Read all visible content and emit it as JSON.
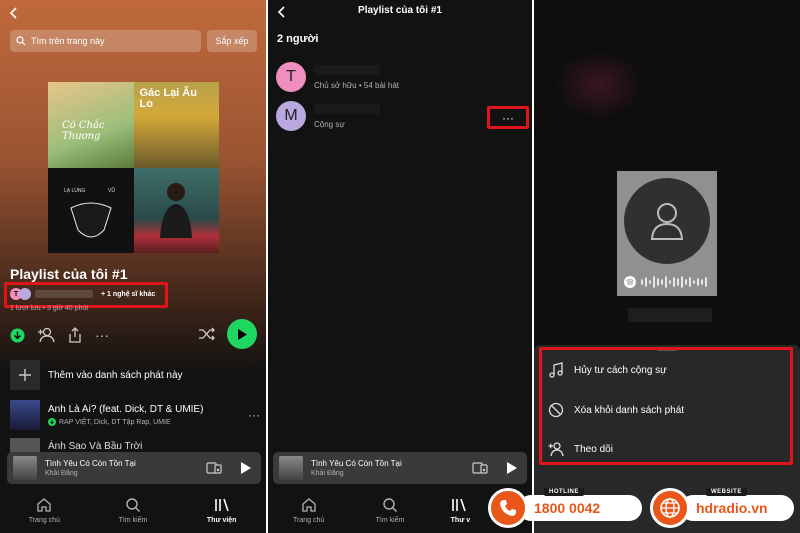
{
  "panel1": {
    "search_placeholder": "Tìm trên trang này",
    "sort_label": "Sắp xếp",
    "playlist_title": "Playlist của tôi #1",
    "collab_text": "+ 1 nghệ sĩ khác",
    "avatar_letter": "T",
    "meta": "1 lượt lưu • 3 giờ 40 phút",
    "add_label": "Thêm vào danh sách phát này",
    "tracks": [
      {
        "title": "Anh Là Ai? (feat. Dick, DT & UMIE)",
        "artist": "RAP VIỆT, Dick, DT Tập Rap, UMIE"
      },
      {
        "title": "Ánh Sao Và Bầu Trời",
        "artist": ""
      }
    ],
    "cover_texts": [
      "Gác Lại Âu Lo",
      "LẠ LÙNG",
      "VŨ",
      "Có Chắc Thương"
    ]
  },
  "miniplayer": {
    "title": "Tình Yêu Có Còn Tồn Tại",
    "artist": "Khải Đăng"
  },
  "nav": {
    "home": "Trang chủ",
    "search": "Tìm kiếm",
    "library": "Thư viện",
    "library_short": "Thư v"
  },
  "panel2": {
    "title": "Playlist của tôi #1",
    "people_count": "2 người",
    "members": [
      {
        "letter": "T",
        "role": "Chủ sở hữu • 54 bài hát",
        "color": "#f08fbf"
      },
      {
        "letter": "M",
        "role": "Cộng sự",
        "color": "#b9a7e0"
      }
    ],
    "more": "···"
  },
  "panel3": {
    "menu": [
      "Hủy tư cách cộng sự",
      "Xóa khỏi danh sách phát",
      "Theo dõi"
    ]
  },
  "branding": {
    "hotline_tag": "HOTLINE",
    "hotline": "1800 0042",
    "website_tag": "WEBSITE",
    "website": "hdradio.vn"
  },
  "colors": {
    "accent": "#1ed760",
    "highlight": "#e1141b",
    "brand": "#e8561a"
  }
}
